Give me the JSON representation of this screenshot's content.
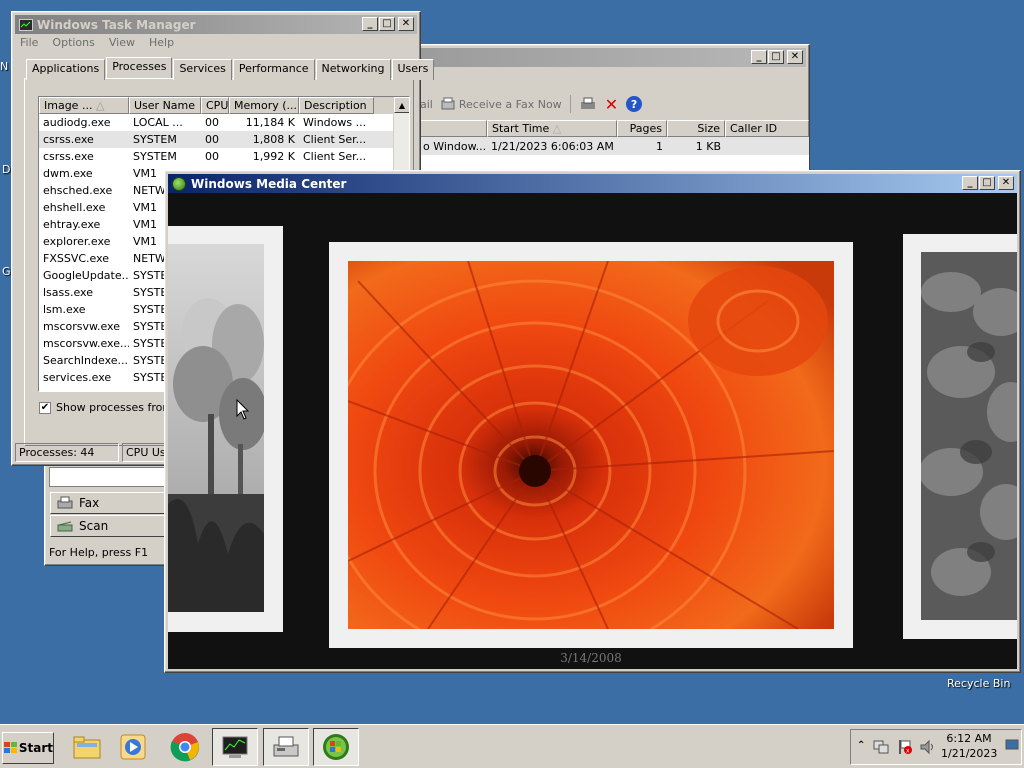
{
  "desktop": {
    "recycle_bin_label": "Recycle Bin"
  },
  "taskmgr": {
    "title": "Windows Task Manager",
    "menu": [
      "File",
      "Options",
      "View",
      "Help"
    ],
    "tabs": [
      "Applications",
      "Processes",
      "Services",
      "Performance",
      "Networking",
      "Users"
    ],
    "active_tab": "Processes",
    "columns": [
      "Image ...",
      "User Name",
      "CPU",
      "Memory (...",
      "Description"
    ],
    "rows": [
      [
        "audiodg.exe",
        "LOCAL ...",
        "00",
        "11,184 K",
        "Windows ..."
      ],
      [
        "csrss.exe",
        "SYSTEM",
        "00",
        "1,808 K",
        "Client Ser..."
      ],
      [
        "csrss.exe",
        "SYSTEM",
        "00",
        "1,992 K",
        "Client Ser..."
      ],
      [
        "dwm.exe",
        "VM1",
        "",
        "",
        ""
      ],
      [
        "ehsched.exe",
        "NETW",
        "",
        "",
        ""
      ],
      [
        "ehshell.exe",
        "VM1",
        "",
        "",
        ""
      ],
      [
        "ehtray.exe",
        "VM1",
        "",
        "",
        ""
      ],
      [
        "explorer.exe",
        "VM1",
        "",
        "",
        ""
      ],
      [
        "FXSSVC.exe",
        "NETW",
        "",
        "",
        ""
      ],
      [
        "GoogleUpdate...",
        "SYSTE",
        "",
        "",
        ""
      ],
      [
        "lsass.exe",
        "SYSTE",
        "",
        "",
        ""
      ],
      [
        "lsm.exe",
        "SYSTE",
        "",
        "",
        ""
      ],
      [
        "mscorsvw.exe",
        "SYSTE",
        "",
        "",
        ""
      ],
      [
        "mscorsvw.exe...",
        "SYSTE",
        "",
        "",
        ""
      ],
      [
        "SearchIndexe...",
        "SYSTE",
        "",
        "",
        ""
      ],
      [
        "services.exe",
        "SYSTE",
        "",
        "",
        ""
      ]
    ],
    "show_all_label": "Show processes from a",
    "status_processes": "Processes: 44",
    "status_cpu": "CPU Usa"
  },
  "fax": {
    "toolbar": [
      "ail",
      "Receive a Fax Now"
    ],
    "columns": [
      "",
      "Start Time",
      "Pages",
      "Size",
      "Caller ID"
    ],
    "row": [
      "o Window...",
      "1/21/2023 6:06:03 AM",
      "1",
      "1 KB",
      ""
    ],
    "nav_fax": "Fax",
    "nav_scan": "Scan",
    "status": "For Help, press F1"
  },
  "wmc": {
    "title": "Windows Media Center",
    "photo_date": "3/14/2008"
  },
  "taskbar": {
    "start_label": "Start",
    "clock_time": "6:12 AM",
    "clock_date": "1/21/2023"
  }
}
